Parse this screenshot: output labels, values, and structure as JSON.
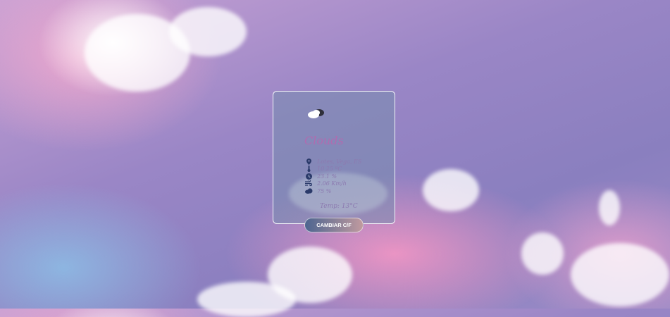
{
  "weather": {
    "condition": "Clouds",
    "icon": "cloud-sun-icon",
    "details": [
      {
        "icon": "location-pin-icon",
        "text": "Lotes, Vega, ES"
      },
      {
        "icon": "thermometer-icon",
        "text": "10.25 ºC"
      },
      {
        "icon": "clock-icon",
        "text": "23.1 %"
      },
      {
        "icon": "wind-icon",
        "text": "2.06 Km/h"
      },
      {
        "icon": "cloud-icon",
        "text": "75 %"
      }
    ],
    "temperature_label": "Temp: 13°C"
  },
  "toggle_button": {
    "label": "CAMBIAR C/F"
  },
  "colors": {
    "city": "#b06bb0",
    "detail_text": "#8c7ab0",
    "icons": "#2b3a6a"
  }
}
